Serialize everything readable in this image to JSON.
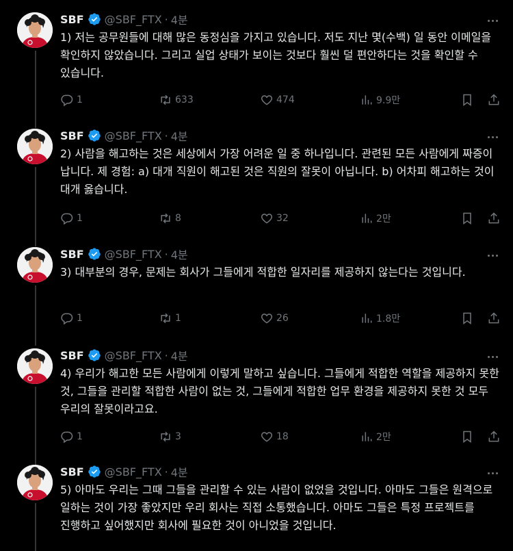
{
  "author": {
    "name": "SBF",
    "handle": "@SBF_FTX",
    "separator": "·"
  },
  "colors": {
    "background": "#000000",
    "text": "#e7e9ea",
    "muted": "#71767b",
    "verified": "#1d9bf0",
    "avatar_shirt": "#c8102e"
  },
  "icons": [
    "more-icon",
    "reply-icon",
    "retweet-icon",
    "like-icon",
    "views-icon",
    "bookmark-icon",
    "share-icon",
    "verified-badge-icon"
  ],
  "tweets": [
    {
      "time": "4분",
      "text": "1) 저는 공무원들에 대해 많은 동정심을 가지고 있습니다. 저도 지난 몇(수백) 일 동안 이메일을 확인하지 않았습니다. 그리고 실업 상태가 보이는 것보다 훨씬 덜 편안하다는 것을 확인할 수 있습니다.",
      "replies": "1",
      "retweets": "633",
      "likes": "474",
      "views": "9.9만"
    },
    {
      "time": "4분",
      "text": "2) 사람을 해고하는 것은 세상에서 가장 어려운 일 중 하나입니다. 관련된 모든 사람에게 짜증이 납니다. 제 경험: a) 대개 직원이 해고된 것은 직원의 잘못이 아닙니다. b) 어차피 해고하는 것이 대개 옳습니다.",
      "replies": "1",
      "retweets": "8",
      "likes": "32",
      "views": "2만"
    },
    {
      "time": "4분",
      "text": "3) 대부분의 경우, 문제는 회사가 그들에게 적합한 일자리를 제공하지 않는다는 것입니다.",
      "replies": "1",
      "retweets": "1",
      "likes": "26",
      "views": "1.8만"
    },
    {
      "time": "4분",
      "text": "4) 우리가 해고한 모든 사람에게 이렇게 말하고 싶습니다. 그들에게 적합한 역할을 제공하지 못한 것, 그들을 관리할 적합한 사람이 없는 것, 그들에게 적합한 업무 환경을 제공하지 못한 것 모두 우리의 잘못이라고요.",
      "replies": "1",
      "retweets": "3",
      "likes": "18",
      "views": "2만"
    },
    {
      "time": "4분",
      "text": "5) 아마도 우리는 그때 그들을 관리할 수 있는 사람이 없었을 것입니다. 아마도 그들은 원격으로 일하는 것이 가장 좋았지만 우리 회사는 직접 소통했습니다. 아마도 그들은 특정 프로젝트를 진행하고 싶어했지만 회사에 필요한 것이 아니었을 것입니다."
    }
  ]
}
